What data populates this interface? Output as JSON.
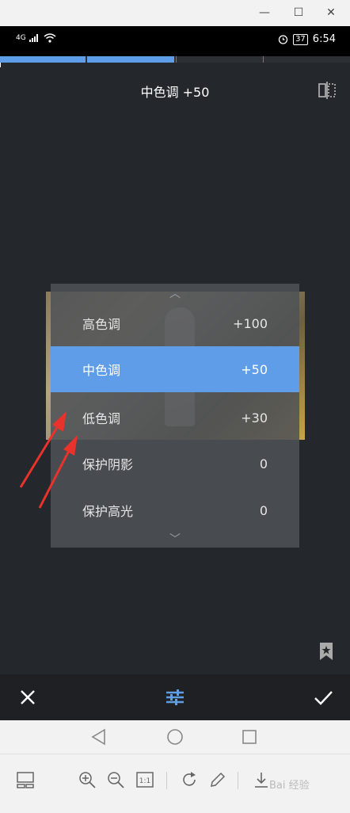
{
  "window": {
    "controls": [
      "—",
      "☐",
      "✕"
    ]
  },
  "status_bar": {
    "network": "4G",
    "time": "6:54",
    "battery": "37"
  },
  "progress_segments": [
    {
      "state": "filled",
      "color": "#5f9de8"
    },
    {
      "state": "filled",
      "color": "#5f9de8"
    },
    {
      "state": "empty",
      "color": "#2c2f33"
    },
    {
      "state": "empty",
      "color": "#2c2f33"
    }
  ],
  "header": {
    "title": "中色调 +50"
  },
  "adjust_menu": {
    "items": [
      {
        "label": "高色调",
        "value": "+100"
      },
      {
        "label": "中色调",
        "value": "+50",
        "selected": true
      },
      {
        "label": "低色调",
        "value": "+30"
      },
      {
        "label": "保护阴影",
        "value": "0"
      },
      {
        "label": "保护高光",
        "value": "0"
      }
    ]
  },
  "colors": {
    "accent": "#5f9de8",
    "background": "#24272b",
    "arrow": "#e8322c"
  },
  "watermark": "Bai 经验"
}
